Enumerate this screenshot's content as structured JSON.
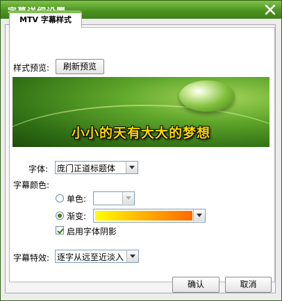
{
  "window": {
    "title": "字幕详细设置",
    "close_icon": "close-icon"
  },
  "tab": {
    "label": "MTV 字幕样式"
  },
  "preview": {
    "label": "样式预览:",
    "refresh_button": "刷新预览",
    "sample_text": "小小的天有大大的梦想"
  },
  "font": {
    "label": "字体:",
    "value": "庞门正道标题体"
  },
  "color": {
    "label": "字幕颜色:",
    "single_label": "单色:",
    "gradient_label": "渐变:",
    "selected": "gradient",
    "gradient_from": "#ffff00",
    "gradient_to": "#ff6a00",
    "shadow_label": "启用字体阴影",
    "shadow_checked": true
  },
  "effect": {
    "label": "字幕特效:",
    "value": "逐字从远至近淡入"
  },
  "buttons": {
    "ok": "确认",
    "cancel": "取消"
  },
  "colors": {
    "title_bar": "#4d9421",
    "accent": "#7ac24a"
  }
}
